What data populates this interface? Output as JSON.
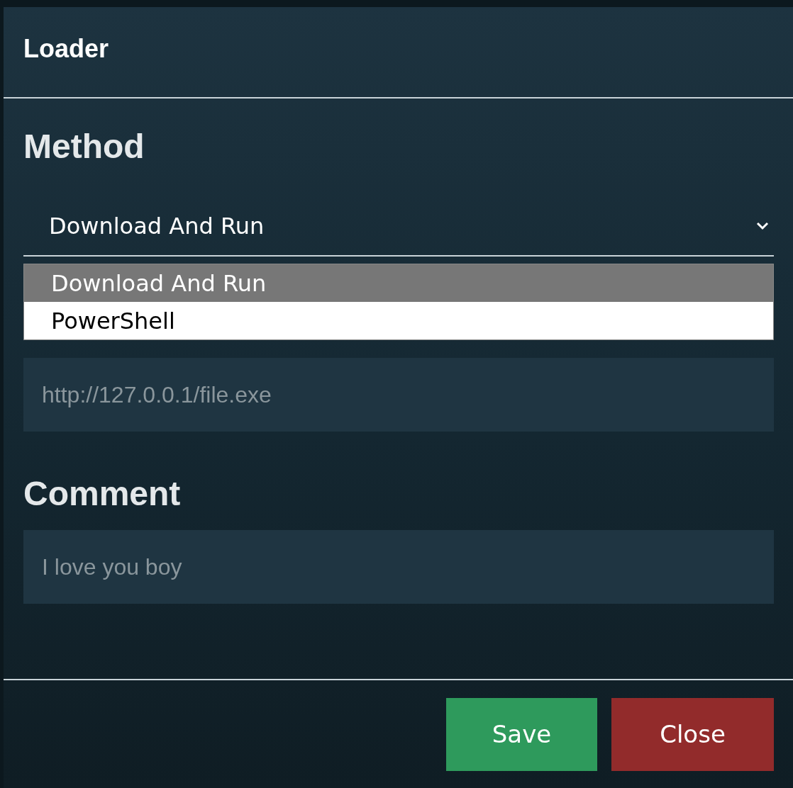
{
  "modal": {
    "title": "Loader"
  },
  "method": {
    "label": "Method",
    "value": "Download And Run",
    "expanded": true,
    "options": [
      {
        "label": "Download And Run",
        "selected": true
      },
      {
        "label": "PowerShell",
        "selected": false
      }
    ]
  },
  "url_field": {
    "placeholder": "http://127.0.0.1/file.exe"
  },
  "comment": {
    "label": "Comment",
    "placeholder": "I love you boy"
  },
  "buttons": [
    {
      "label": "Save",
      "kind": "primary"
    },
    {
      "label": "Close",
      "kind": "danger"
    }
  ]
}
